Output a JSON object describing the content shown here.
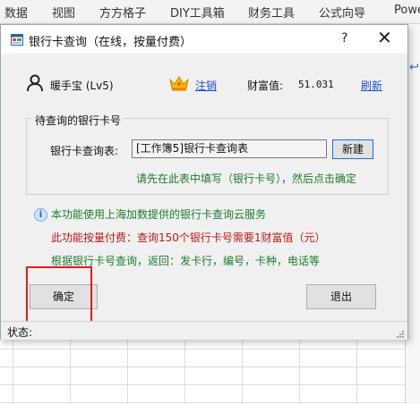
{
  "ribbon": {
    "tabs": [
      "数据",
      "视图",
      "方方格子",
      "DIY工具箱",
      "财务工具",
      "公式向导",
      "Powe"
    ]
  },
  "dialog": {
    "title": "银行卡查询（在线，按量付费）",
    "help_label": "?",
    "close_label": "✕",
    "user": {
      "name": "暖手宝 (Lv5)",
      "logout_label": "注销",
      "wealth_label": "财富值:",
      "wealth_value": "51.031",
      "refresh_label": "刷新"
    },
    "group": {
      "title": "待查询的银行卡号",
      "table_label": "银行卡查询表:",
      "table_value": "[工作簿5]银行卡查询表",
      "new_button": "新建",
      "hint": "请先在此表中填写（银行卡号），然后点击确定"
    },
    "info": {
      "line1": "本功能使用上海加数提供的银行卡查询云服务",
      "line2": "此功能按量付费：查询150个银行卡号需要1财富值（元）",
      "line3": "根据银行卡号查询，返回：发卡行，编号，卡种，电话等"
    },
    "buttons": {
      "ok": "确定",
      "exit": "退出"
    },
    "status": {
      "label": "状态:"
    }
  },
  "colors": {
    "link": "#1a4fd6",
    "green_text": "#1a7d2c",
    "red_text": "#c01818",
    "highlight_box": "#e21c1c",
    "crown": "#f0a800"
  }
}
